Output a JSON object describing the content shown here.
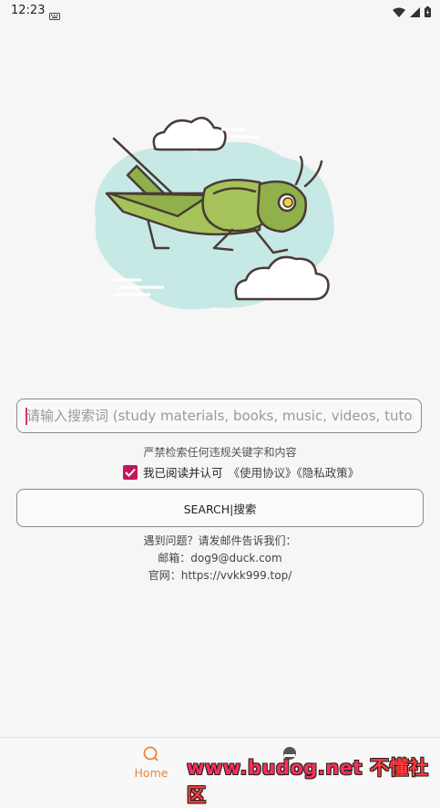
{
  "status_bar": {
    "time": "12:23"
  },
  "search": {
    "placeholder": "请输入搜索词 (study materials, books, music, videos, tutoria",
    "value": ""
  },
  "notice": "严禁检索任何违规关键字和内容",
  "agreement": {
    "checked": true,
    "text": "我已阅读并认可",
    "links": "《使用协议》《隐私政策》"
  },
  "search_button_label": "SEARCH|搜索",
  "contact": {
    "line1": "遇到问题？请发邮件告诉我们：",
    "email_line": "邮箱：dog9@duck.com",
    "website_line": "官网：https://vvkk999.top/"
  },
  "bottom_nav": {
    "home_label": "Home",
    "second_label": "",
    "active_color": "#e8873a"
  },
  "watermark": {
    "url": "www.budog.net",
    "text": "不懂社区"
  }
}
